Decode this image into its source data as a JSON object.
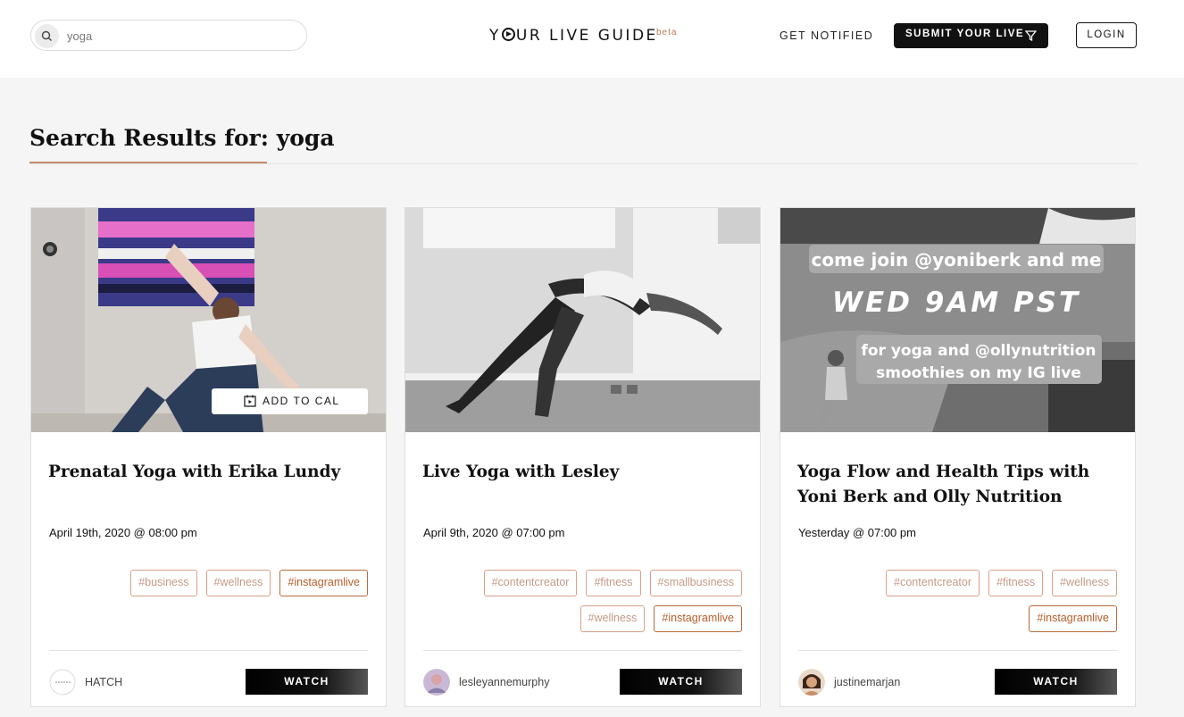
{
  "search": {
    "value": "yoga"
  },
  "header": {
    "logo_left": "Y",
    "logo_right": "UR LIVE GUIDE",
    "beta": "beta",
    "get_notified": "GET NOTIFIED",
    "submit": "SUBMIT YOUR LIVE",
    "login": "LOGIN"
  },
  "page": {
    "title": "Search Results for: yoga"
  },
  "cards": [
    {
      "title": "Prenatal Yoga with Erika Lundy",
      "date": "April 19th, 2020 @ 08:00 pm",
      "tags": [
        "#business",
        "#wellness",
        "#instagramlive"
      ],
      "owner": "HATCH",
      "watch": "WATCH",
      "add_to_cal": "ADD TO CAL"
    },
    {
      "title": "Live Yoga with Lesley",
      "date": "April 9th, 2020 @ 07:00 pm",
      "tags": [
        "#contentcreator",
        "#fitness",
        "#smallbusiness",
        "#wellness",
        "#instagramlive"
      ],
      "owner": "lesleyannemurphy",
      "watch": "WATCH"
    },
    {
      "title": "Yoga Flow and Health Tips with Yoni Berk and Olly Nutrition",
      "date": "Yesterday @ 07:00 pm",
      "tags": [
        "#contentcreator",
        "#fitness",
        "#wellness",
        "#instagramlive"
      ],
      "owner": "justinemarjan",
      "watch": "WATCH",
      "image_text": {
        "line1": "come join @yoniberk and me",
        "line2": "WED 9AM PST",
        "line3": "for yoga and @ollynutrition",
        "line4": "smoothies on my IG live"
      }
    }
  ],
  "colors": {
    "accent": "#c58b6c",
    "tag_hot": "#b85e2b",
    "tag": "#c59a88"
  }
}
